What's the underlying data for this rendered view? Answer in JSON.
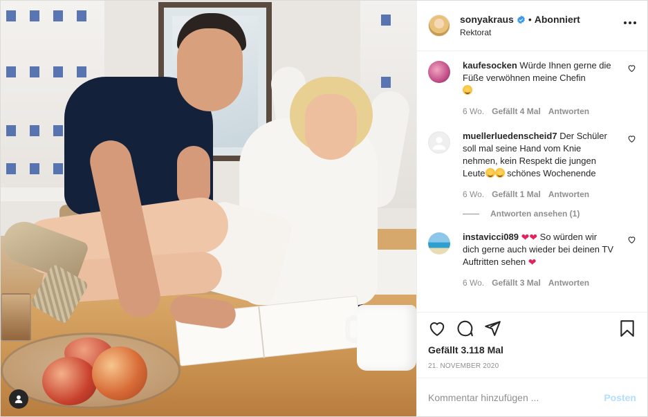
{
  "post": {
    "author": {
      "username": "sonyakraus",
      "verified": true,
      "separator": "•",
      "follow_status": "Abonniert",
      "location": "Rektorat",
      "avatar_icon": "profile-photo"
    },
    "photo": {
      "description_icon": "user-tag-icon"
    },
    "comments": [
      {
        "username": "kaufesocken",
        "text": "Würde Ihnen gerne die Füße verwöhnen meine Chefin",
        "emojis": [
          "grinning-face"
        ],
        "age": "6 Wo.",
        "likes": "Gefällt 4 Mal",
        "reply": "Antworten"
      },
      {
        "username": "muellerluedenscheid7",
        "text": "Der Schüler soll mal seine Hand vom Knie nehmen, kein Respekt die jungen Leute",
        "text2": "schönes Wochenende",
        "emojis": [
          "grinning-face",
          "grinning-face"
        ],
        "age": "6 Wo.",
        "likes": "Gefällt 1 Mal",
        "reply": "Antworten",
        "view_replies": "Antworten ansehen (1)"
      },
      {
        "username": "instavicci089",
        "text": "So würden wir dich gerne auch wieder bei deinen TV Auftritten sehen",
        "emojis": [
          "red-heart",
          "red-heart",
          "red-heart"
        ],
        "age": "6 Wo.",
        "likes": "Gefällt 3 Mal",
        "reply": "Antworten"
      }
    ],
    "likes_count": "Gefällt 3.118 Mal",
    "date": "21. NOVEMBER 2020",
    "comment_input": {
      "placeholder": "Kommentar hinzufügen ...",
      "value": ""
    },
    "post_button": "Posten"
  },
  "colors": {
    "text": "#262626",
    "secondary": "#8e8e8e",
    "border": "#efefef",
    "verified": "#3897f0",
    "post_button_disabled": "#b2dffc",
    "heart_red": "#e0245e"
  }
}
